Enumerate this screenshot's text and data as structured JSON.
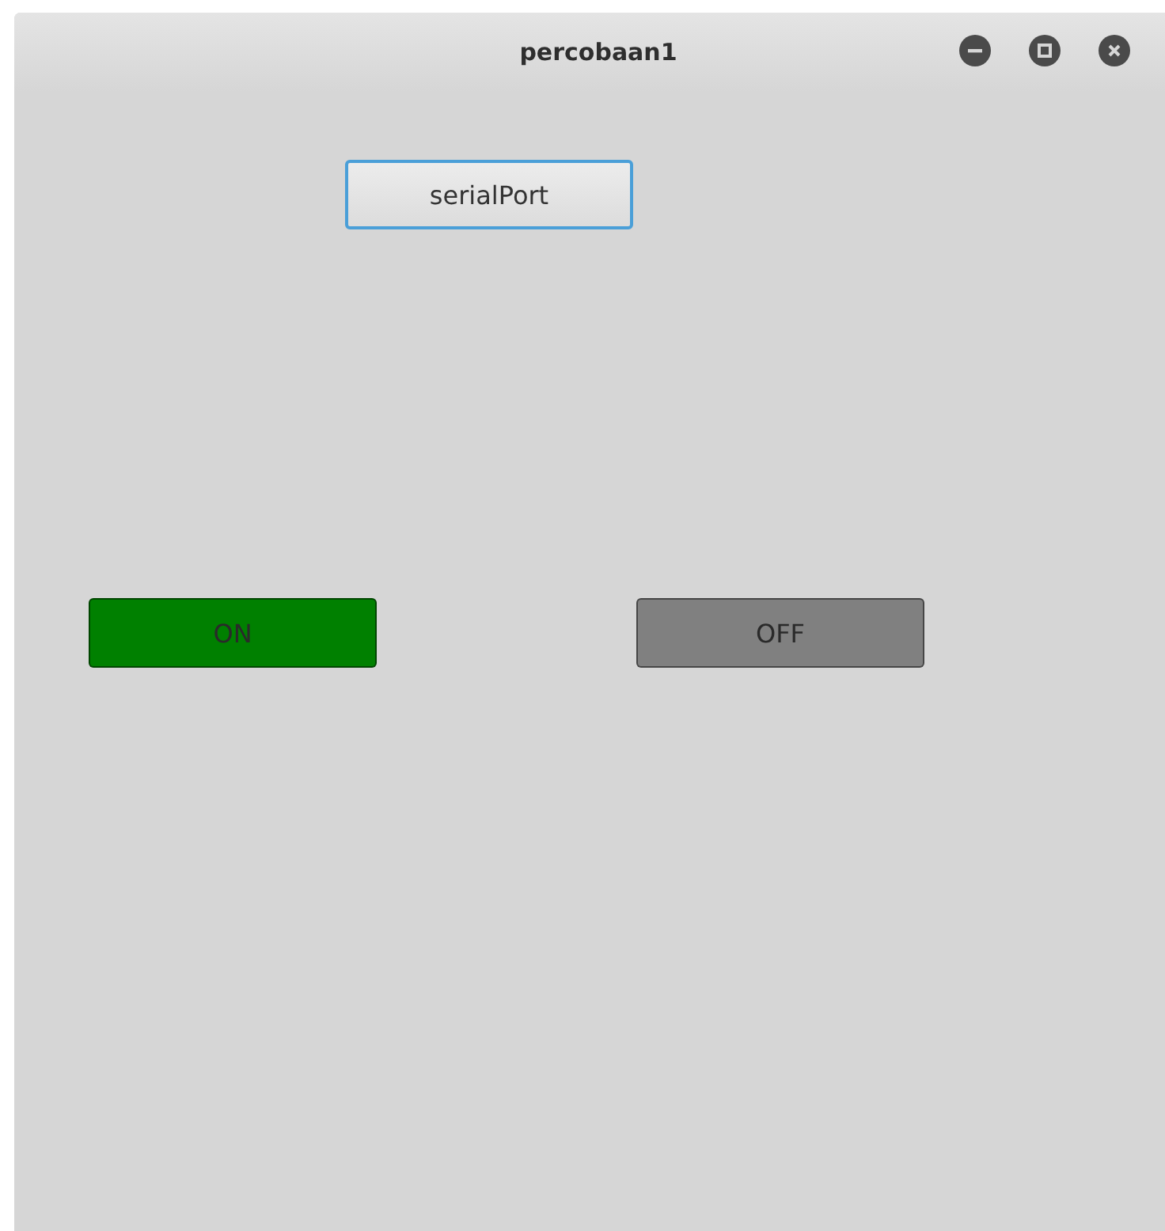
{
  "window": {
    "title": "percobaan1"
  },
  "serial_button": {
    "label": "serialPort",
    "focused": true
  },
  "switch_buttons": [
    {
      "label": "ON",
      "color": "#008000"
    },
    {
      "label": "OFF",
      "color": "#808080"
    }
  ]
}
